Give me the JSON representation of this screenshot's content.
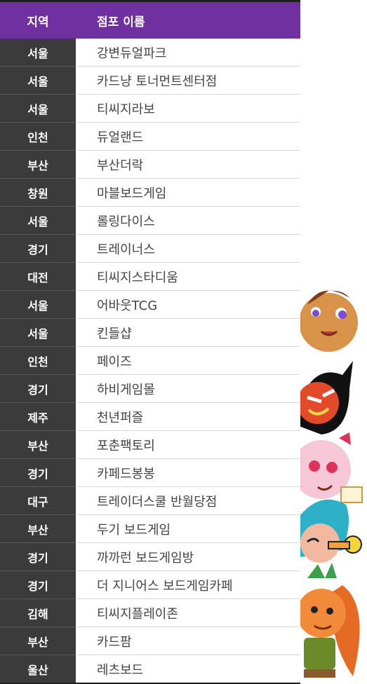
{
  "table": {
    "headers": {
      "region": "지역",
      "name": "점포 이름"
    },
    "rows": [
      {
        "region": "서울",
        "name": "강변듀얼파크"
      },
      {
        "region": "서울",
        "name": "카드냥 토너먼트센터점"
      },
      {
        "region": "서울",
        "name": "티씨지라보"
      },
      {
        "region": "인천",
        "name": "듀얼랜드"
      },
      {
        "region": "부산",
        "name": "부산더락"
      },
      {
        "region": "창원",
        "name": "마블보드게임"
      },
      {
        "region": "서울",
        "name": "롤링다이스"
      },
      {
        "region": "경기",
        "name": "트레이너스"
      },
      {
        "region": "대전",
        "name": "티씨지스타디움"
      },
      {
        "region": "서울",
        "name": "어바웃TCG"
      },
      {
        "region": "서울",
        "name": "킨들샵"
      },
      {
        "region": "인천",
        "name": "페이즈"
      },
      {
        "region": "경기",
        "name": "하비게임몰"
      },
      {
        "region": "제주",
        "name": "천년퍼즐"
      },
      {
        "region": "부산",
        "name": "포춘팩토리"
      },
      {
        "region": "경기",
        "name": "카페드봉봉"
      },
      {
        "region": "대구",
        "name": "트레이더스쿨 반월당점"
      },
      {
        "region": "부산",
        "name": "두기 보드게임"
      },
      {
        "region": "경기",
        "name": "까까런 보드게임방"
      },
      {
        "region": "경기",
        "name": "더 지니어스 보드게임카페"
      },
      {
        "region": "김해",
        "name": "티씨지플레이존"
      },
      {
        "region": "부산",
        "name": "카드팜"
      },
      {
        "region": "울산",
        "name": "레츠보드"
      }
    ]
  },
  "colors": {
    "header_bg": "#7030a0",
    "region_bg": "#3b3b3b"
  },
  "decoration": {
    "icon": "cookie-characters-illustration"
  }
}
